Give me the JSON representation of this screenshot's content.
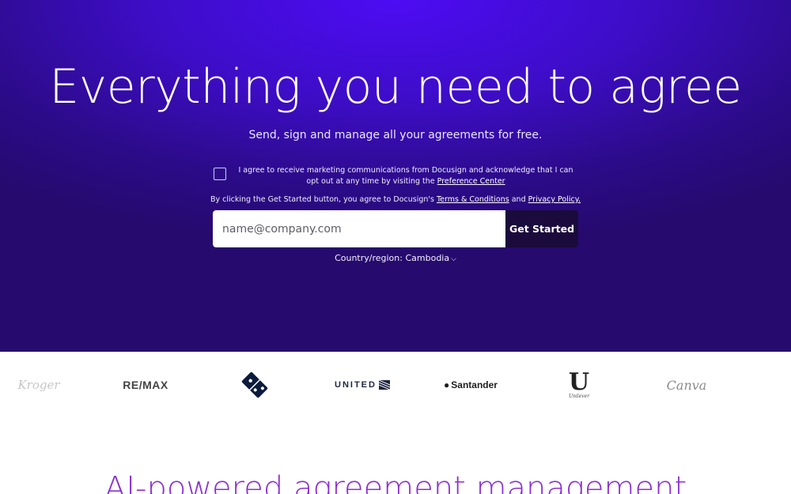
{
  "hero": {
    "title": "Everything you need to agree",
    "subtitle": "Send, sign and manage all your agreements for free.",
    "consent": {
      "text_before_link": "I agree to receive marketing communications from Docusign and acknowledge that I can opt out at any time by visiting the ",
      "link_label": "Preference Center",
      "checked": false
    },
    "terms": {
      "prefix": "By clicking the Get Started button, you agree to Docusign's ",
      "terms_link": "Terms & Conditions",
      "joiner": " and ",
      "privacy_link": "Privacy Policy."
    },
    "email": {
      "placeholder": "name@company.com",
      "value": ""
    },
    "cta_label": "Get Started",
    "country": {
      "label": "Country/region: ",
      "value": "Cambodia"
    }
  },
  "logos": [
    {
      "name": "Kroger",
      "text": "Kroger"
    },
    {
      "name": "RE/MAX",
      "text": "RE/MAX"
    },
    {
      "name": "Domino's",
      "text": ""
    },
    {
      "name": "United",
      "text": "UNITED"
    },
    {
      "name": "Santander",
      "text": "Santander"
    },
    {
      "name": "Unilever",
      "text": "Unilever"
    },
    {
      "name": "Canva",
      "text": "Canva"
    }
  ],
  "section": {
    "title": "AI-powered agreement management"
  },
  "colors": {
    "hero_top": "#4d0cf3",
    "hero_bottom": "#260a6e",
    "cta_bg": "#1a0b3c",
    "section_title": "#8a2fd0"
  }
}
